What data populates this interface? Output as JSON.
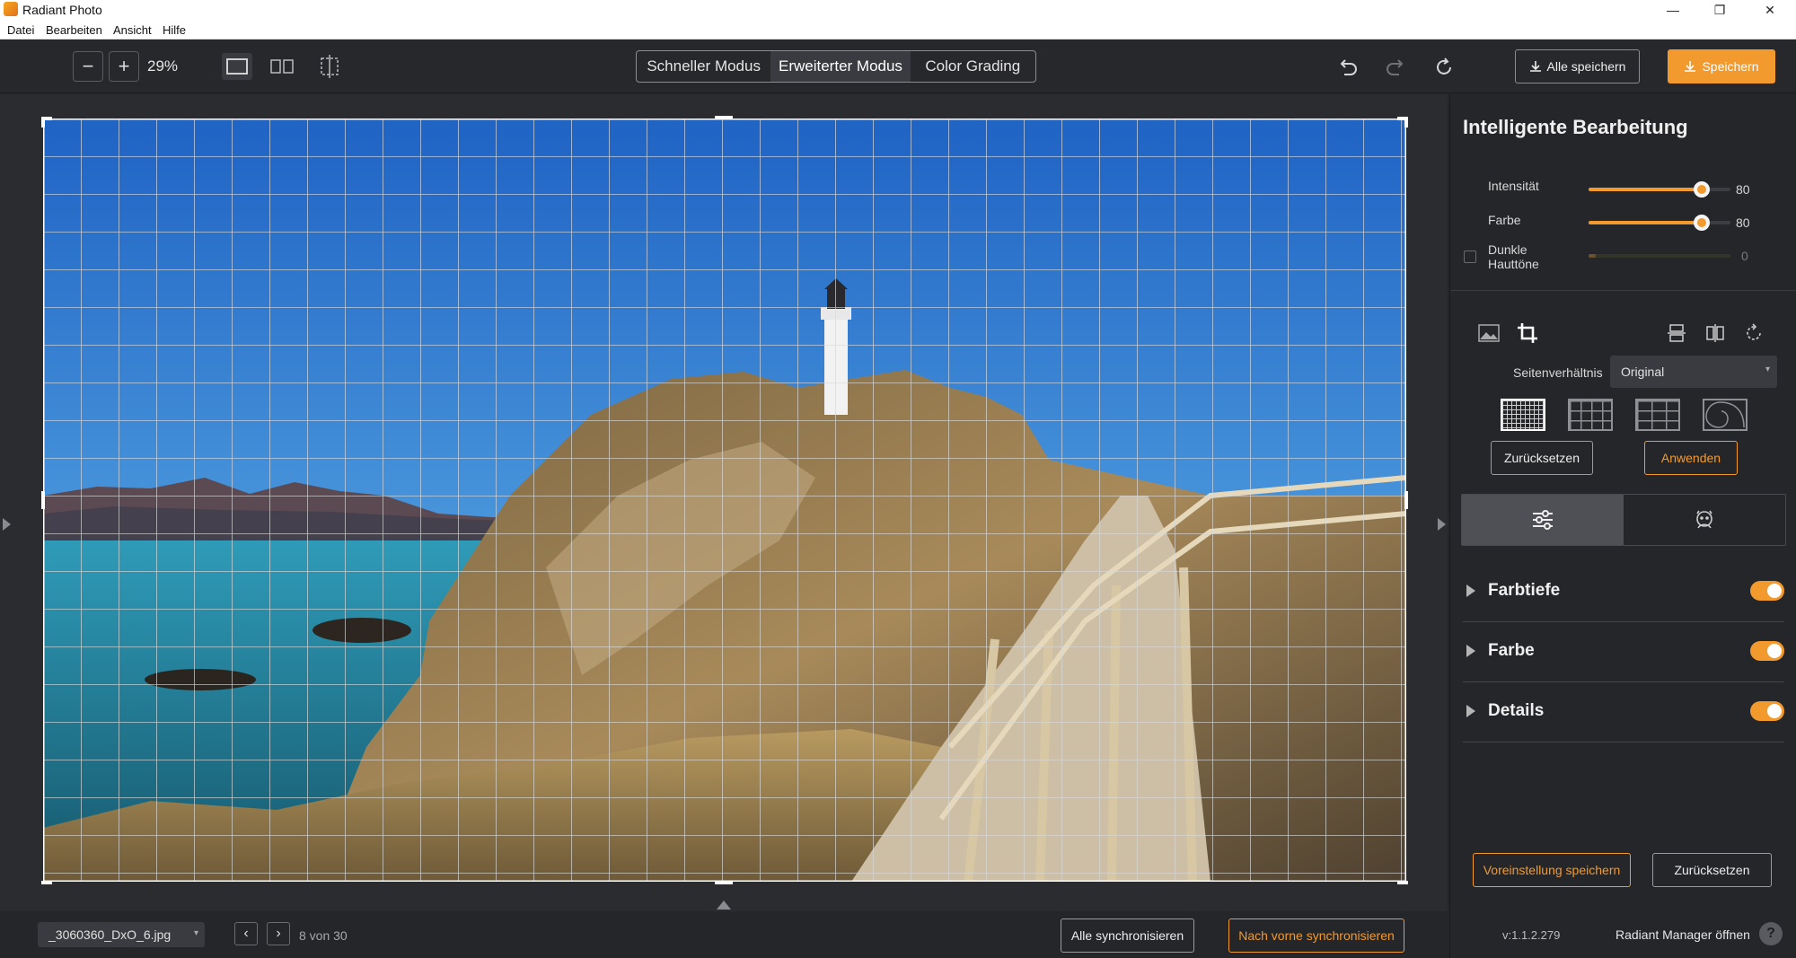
{
  "window": {
    "title": "Radiant Photo",
    "controls": {
      "minimize": "—",
      "maximize": "❐",
      "close": "✕"
    }
  },
  "menu": [
    "Datei",
    "Bearbeiten",
    "Ansicht",
    "Hilfe"
  ],
  "toolbar": {
    "zoom_out": "−",
    "zoom_in": "+",
    "zoom": "29%",
    "modes": [
      {
        "label": "Schneller Modus",
        "active": false
      },
      {
        "label": "Erweiterter Modus",
        "active": true
      },
      {
        "label": "Color Grading",
        "active": false
      }
    ],
    "save_all_label": "Alle speichern",
    "save_label": "Speichern"
  },
  "panel": {
    "title": "Intelligente Bearbeitung",
    "sliders": [
      {
        "label": "Intensität",
        "value": "80",
        "fraction": 0.8,
        "enabled": true
      },
      {
        "label": "Farbe",
        "value": "80",
        "fraction": 0.8,
        "enabled": true
      },
      {
        "label": "Dunkle Hauttöne",
        "value": "0",
        "fraction": 0.0,
        "enabled": false
      }
    ],
    "crop": {
      "aspect_label": "Seitenverhältnis",
      "aspect_value": "Original",
      "reset_label": "Zurücksetzen",
      "apply_label": "Anwenden"
    },
    "sections": [
      {
        "label": "Farbtiefe",
        "on": true
      },
      {
        "label": "Farbe",
        "on": true
      },
      {
        "label": "Details",
        "on": true
      }
    ],
    "save_preset_label": "Voreinstellung speichern",
    "reset_all_label": "Zurücksetzen",
    "version": "v:1.1.2.279",
    "manager_label": "Radiant Manager öffnen",
    "help_label": "?"
  },
  "bottom": {
    "filename": "_3060360_DxO_6.jpg",
    "prev": "‹",
    "next": "›",
    "counter": "8 von 30",
    "sync_all_label": "Alle synchronisieren",
    "sync_forward_label": "Nach vorne synchronisieren"
  },
  "colors": {
    "accent": "#f29a2e",
    "panel_bg": "#25262a",
    "canvas_bg": "#2b2c30"
  }
}
